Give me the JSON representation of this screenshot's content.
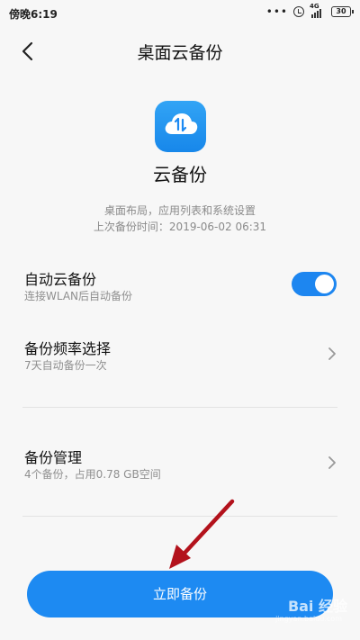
{
  "status_bar": {
    "time": "傍晚6:19",
    "dots": "•••",
    "network": "4G",
    "battery": "30"
  },
  "header": {
    "title": "桌面云备份",
    "back_icon": "chevron-left-icon"
  },
  "app": {
    "icon": "cloud-sync-icon",
    "name": "云备份",
    "description": "桌面布局，应用列表和系统设置",
    "last_backup": "上次备份时间：2019-06-02 06:31"
  },
  "settings": {
    "auto_backup": {
      "title": "自动云备份",
      "subtitle": "连接WLAN后自动备份",
      "enabled": true
    },
    "frequency": {
      "title": "备份频率选择",
      "subtitle": "7天自动备份一次"
    },
    "management": {
      "title": "备份管理",
      "subtitle": "4个备份，占用0.78 GB空间"
    }
  },
  "action": {
    "backup_now": "立即备份"
  },
  "watermark": {
    "text": "Bai 经验",
    "sub": "jingyan.baidu.com"
  },
  "colors": {
    "accent": "#1d8af2",
    "annotation_arrow": "#b3121c"
  }
}
